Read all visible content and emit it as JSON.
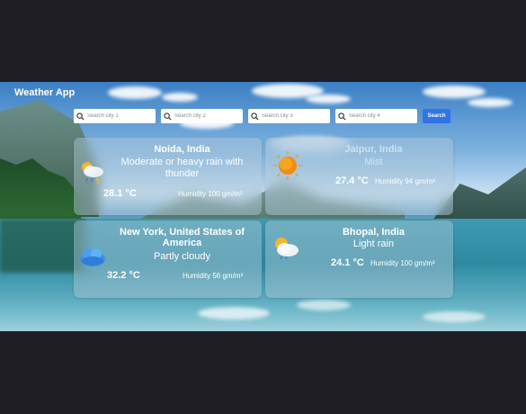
{
  "app": {
    "title": "Weather App"
  },
  "search": {
    "placeholders": [
      "Search city 1",
      "Search city 2",
      "Search city 3",
      "Search city 4"
    ],
    "button_label": "Search"
  },
  "cards": [
    {
      "city": "Noida, India",
      "condition": "Moderate or heavy rain with thunder",
      "temperature": "28.1 °C",
      "humidity": "Humidity 100 gm/m³",
      "icon": "thunder-rain-icon"
    },
    {
      "city": "Jaipur, India",
      "condition": "Mist",
      "temperature": "27.4 °C",
      "humidity": "Humidity 94 gm/m³",
      "icon": "sun-icon"
    },
    {
      "city": "New York, United States of America",
      "condition": "Partly cloudy",
      "temperature": "32.2 °C",
      "humidity": "Humidity 56 gm/m³",
      "icon": "cloud-icon"
    },
    {
      "city": "Bhopal, India",
      "condition": "Light rain",
      "temperature": "24.1 °C",
      "humidity": "Humidity 100 gm/m³",
      "icon": "sun-cloud-icon"
    }
  ]
}
